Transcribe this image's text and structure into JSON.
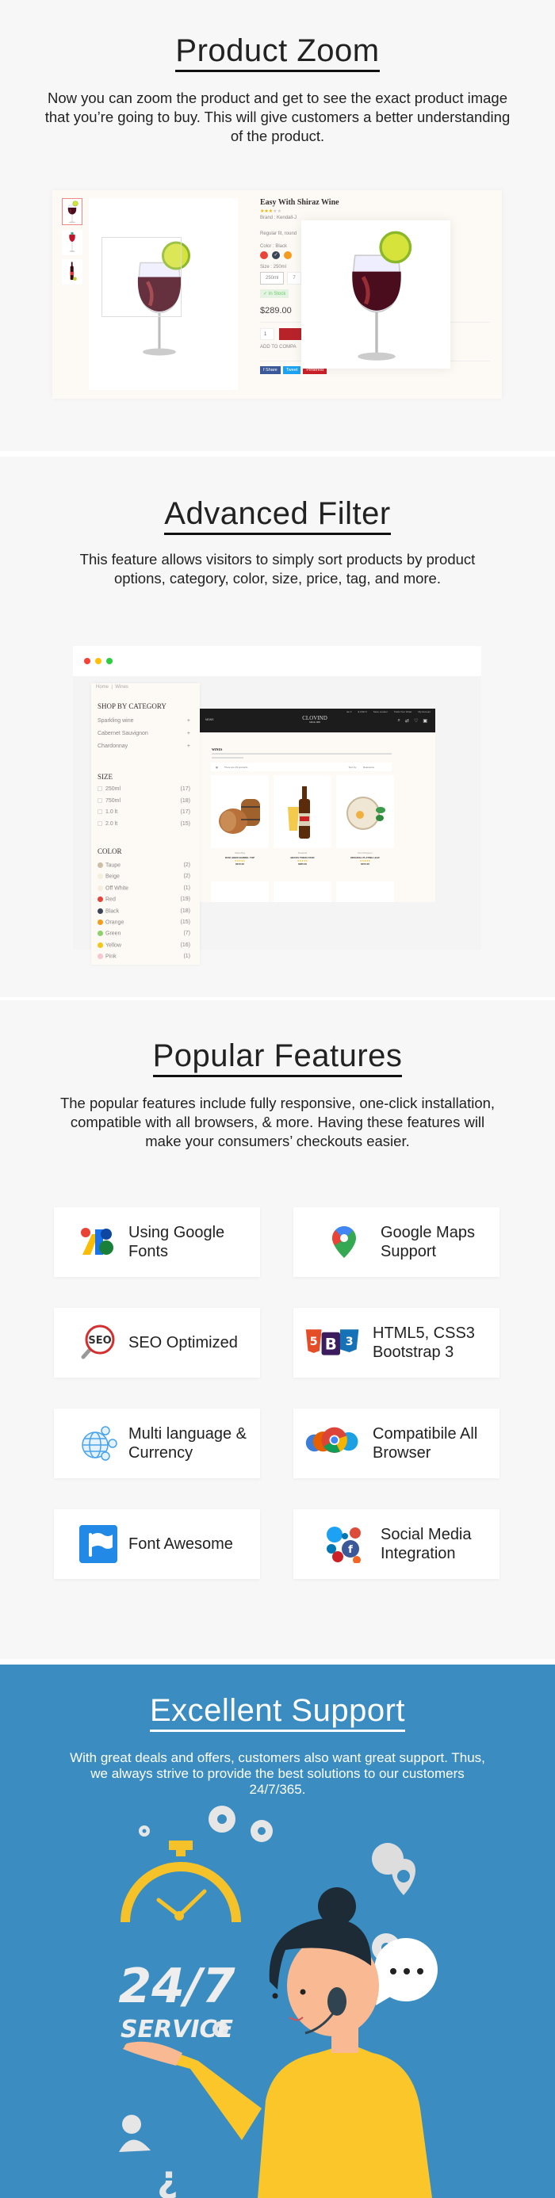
{
  "product_zoom": {
    "title": "Product Zoom",
    "description": "Now you can zoom the product and get to see the exact product image that you’re going to buy. This will give customers a better understanding of the product.",
    "product": {
      "name": "Easy With Shiraz Wine",
      "rating": 3,
      "rating_max": 5,
      "brand": "Brand : Kendall-J",
      "summary": "Regular fit, round",
      "color_label": "Color : Black",
      "swatches": [
        "#e8443a",
        "#3c4557",
        "#f39c1f"
      ],
      "selected_swatch": 1,
      "size_label": "Size : 250ml",
      "size_options": [
        "250ml",
        "7"
      ],
      "stock": "✓ In Stock",
      "price": "$289.00",
      "quantity": "1",
      "compare": "ADD TO COMPA",
      "share_buttons": [
        {
          "label": "f  Share",
          "color": "#3b5998"
        },
        {
          "label": "Tweet",
          "color": "#1da1f2"
        },
        {
          "label": "Pinterest",
          "color": "#cb2027"
        }
      ]
    }
  },
  "advanced_filter": {
    "title": "Advanced Filter",
    "description": "This feature allows visitors to simply sort products by product options, category, color, size, price, tag, and more.",
    "window_dots": [
      "#f44336",
      "#ffc107",
      "#2ecc40"
    ],
    "sidebar": {
      "breadcrumb": [
        "Home",
        "Wines"
      ],
      "category_title": "SHOP BY CATEGORY",
      "categories": [
        "Sparkling wine",
        "Cabernet Sauvignon",
        "Chardonnay"
      ],
      "size_title": "SIZE",
      "sizes": [
        {
          "label": "250ml",
          "count": "(17)"
        },
        {
          "label": "750ml",
          "count": "(18)"
        },
        {
          "label": "1.0 lt",
          "count": "(17)"
        },
        {
          "label": "2.0 lt",
          "count": "(15)"
        }
      ],
      "color_title": "COLOR",
      "colors": [
        {
          "label": "Taupe",
          "count": "(2)",
          "swatch": "#cbbfa8"
        },
        {
          "label": "Beige",
          "count": "(2)",
          "swatch": "#f4f0dc"
        },
        {
          "label": "Off White",
          "count": "(1)",
          "swatch": "#f7eedf"
        },
        {
          "label": "Red",
          "count": "(19)",
          "swatch": "#e8443a"
        },
        {
          "label": "Black",
          "count": "(18)",
          "swatch": "#3c4557"
        },
        {
          "label": "Orange",
          "count": "(15)",
          "swatch": "#f39c1f"
        },
        {
          "label": "Green",
          "count": "(7)",
          "swatch": "#8fd16a"
        },
        {
          "label": "Yellow",
          "count": "(16)",
          "swatch": "#f5c518"
        },
        {
          "label": "Pink",
          "count": "(1)",
          "swatch": "#f7c6d0"
        }
      ]
    },
    "shop": {
      "top_links": [
        "En ▾",
        "$ USD ▾",
        "Store Locator",
        "Track Your Order",
        "My Account"
      ],
      "menu": "NEWS",
      "logo": "CLOVIND",
      "logo_sub": "SINCE 1985",
      "heading": "WINES",
      "products_count": "There are 29 products",
      "sort_label": "Sort by:",
      "sort_value": "Relevance",
      "products": [
        {
          "brand": "Clavia Ray",
          "name": "RUM, BEER BARREL TOP",
          "price": "$210.00",
          "art": "barrel"
        },
        {
          "brand": "Rosebud",
          "name": "BECKS TRIKKI STAR",
          "price": "$280.00",
          "art": "bottle"
        },
        {
          "brand": "Dom Perignon",
          "name": "ORIGINAL PLATING LEAF",
          "price": "$150.00",
          "art": "plate"
        }
      ]
    }
  },
  "popular_features": {
    "title": "Popular Features",
    "description": "The popular features include  fully responsive, one-click installation, compatible with all browsers, & more. Having these features will make your consumers’ checkouts easier.",
    "items": [
      {
        "label": "Using Google Fonts",
        "icon": "google-fonts-icon"
      },
      {
        "label": "Google Maps Support",
        "icon": "google-maps-icon"
      },
      {
        "label": "SEO Optimized",
        "icon": "seo-icon"
      },
      {
        "label": "HTML5, CSS3 Bootstrap 3",
        "icon": "html5-bootstrap-css3-icon"
      },
      {
        "label": "Multi language & Currency",
        "icon": "globe-currency-icon"
      },
      {
        "label": "Compatibile All Browser",
        "icon": "browsers-icon"
      },
      {
        "label": "Font Awesome",
        "icon": "font-awesome-flag-icon"
      },
      {
        "label": "Social Media Integration",
        "icon": "social-media-icon"
      }
    ]
  },
  "excellent_support": {
    "title": "Excellent Support",
    "description": "With great deals and offers, customers also want great support. Thus, we always strive to provide the best solutions to our customers 24/7/365.",
    "badge_top": "24/7",
    "badge_bottom": "SERVICE",
    "background": "#3a8cc1"
  }
}
